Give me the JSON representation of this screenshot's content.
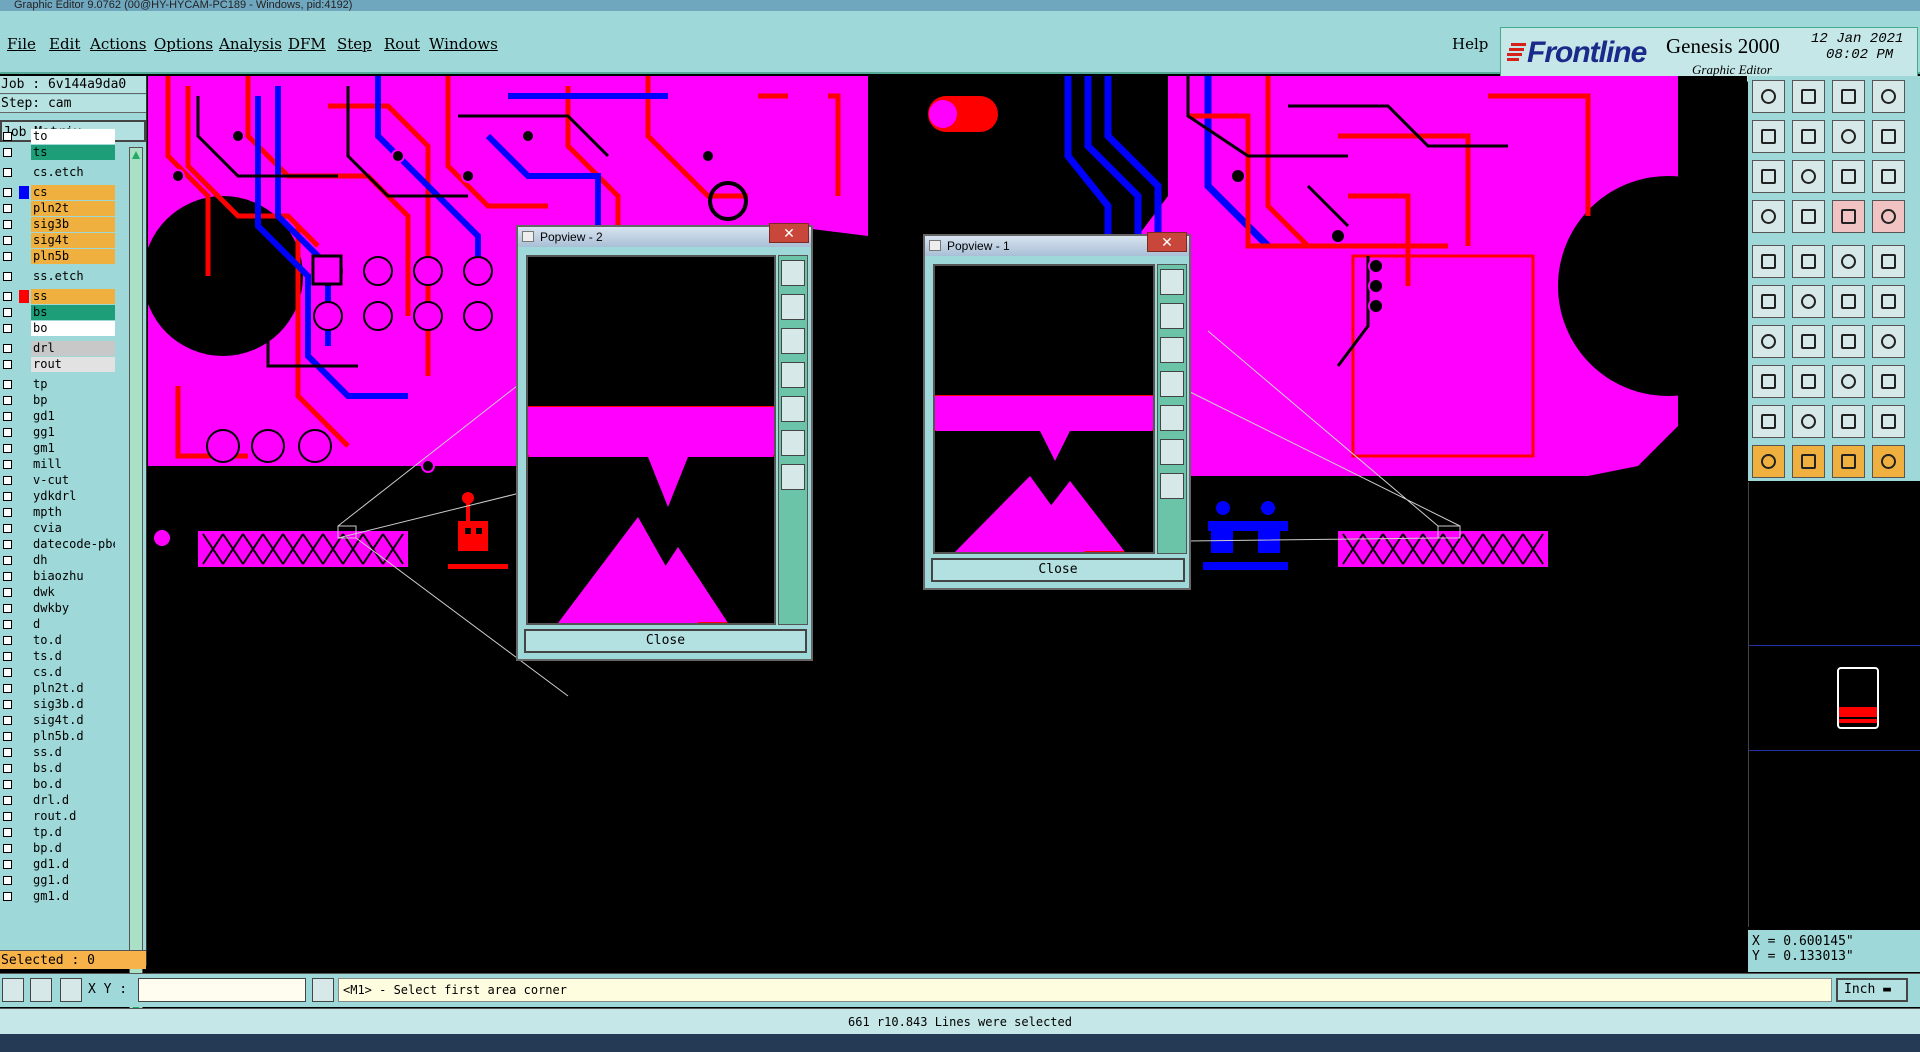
{
  "window": {
    "title": "Graphic Editor 9.0762 (00@HY-HYCAM-PC189 - Windows, pid:4192)"
  },
  "menu": {
    "items": [
      "File",
      "Edit",
      "Actions",
      "Options",
      "Analysis",
      "DFM",
      "Step",
      "Rout",
      "Windows"
    ],
    "help": "Help"
  },
  "brand": {
    "logo_text": "Frontline",
    "product": "Genesis 2000",
    "subtitle": "Graphic Editor",
    "date": "12 Jan 2021",
    "time": "08:02 PM"
  },
  "job": {
    "job_line": "Job : 6v144a9da0",
    "step_line": "Step: cam",
    "matrix_button": "Job Matrix ..."
  },
  "layers": [
    {
      "name": "to",
      "color": "#ffffff",
      "swatch": ""
    },
    {
      "name": "ts",
      "color": "#1e9e78",
      "swatch": ""
    },
    {
      "name": "cs.etch",
      "color": "#9fd8d8",
      "swatch": ""
    },
    {
      "name": "cs",
      "color": "#f0b040",
      "swatch": "#0000ff"
    },
    {
      "name": "pln2t",
      "color": "#f0b040",
      "swatch": ""
    },
    {
      "name": "sig3b",
      "color": "#f0b040",
      "swatch": ""
    },
    {
      "name": "sig4t",
      "color": "#f0b040",
      "swatch": ""
    },
    {
      "name": "pln5b",
      "color": "#f0b040",
      "swatch": ""
    },
    {
      "name": "ss.etch",
      "color": "#9fd8d8",
      "swatch": ""
    },
    {
      "name": "ss",
      "color": "#f0b040",
      "swatch": "#ff0000"
    },
    {
      "name": "bs",
      "color": "#1e9e78",
      "swatch": ""
    },
    {
      "name": "bo",
      "color": "#ffffff",
      "swatch": ""
    },
    {
      "name": "drl",
      "color": "#c8c8c8",
      "swatch": ""
    },
    {
      "name": "rout",
      "color": "#e2e2e2",
      "swatch": ""
    },
    {
      "name": "tp",
      "color": "#9fd8d8",
      "swatch": ""
    },
    {
      "name": "bp",
      "color": "#9fd8d8",
      "swatch": ""
    },
    {
      "name": "gd1",
      "color": "#9fd8d8",
      "swatch": ""
    },
    {
      "name": "gg1",
      "color": "#9fd8d8",
      "swatch": ""
    },
    {
      "name": "gm1",
      "color": "#9fd8d8",
      "swatch": ""
    },
    {
      "name": "mill",
      "color": "#9fd8d8",
      "swatch": ""
    },
    {
      "name": "v-cut",
      "color": "#9fd8d8",
      "swatch": ""
    },
    {
      "name": "ydkdrl",
      "color": "#9fd8d8",
      "swatch": ""
    },
    {
      "name": "mpth",
      "color": "#9fd8d8",
      "swatch": ""
    },
    {
      "name": "cvia",
      "color": "#9fd8d8",
      "swatch": ""
    },
    {
      "name": "datecode-pbe",
      "color": "#9fd8d8",
      "swatch": ""
    },
    {
      "name": "dh",
      "color": "#9fd8d8",
      "swatch": ""
    },
    {
      "name": "biaozhu",
      "color": "#9fd8d8",
      "swatch": ""
    },
    {
      "name": "dwk",
      "color": "#9fd8d8",
      "swatch": ""
    },
    {
      "name": "dwkby",
      "color": "#9fd8d8",
      "swatch": ""
    },
    {
      "name": "d",
      "color": "#9fd8d8",
      "swatch": ""
    },
    {
      "name": "to.d",
      "color": "#9fd8d8",
      "swatch": ""
    },
    {
      "name": "ts.d",
      "color": "#9fd8d8",
      "swatch": ""
    },
    {
      "name": "cs.d",
      "color": "#9fd8d8",
      "swatch": ""
    },
    {
      "name": "pln2t.d",
      "color": "#9fd8d8",
      "swatch": ""
    },
    {
      "name": "sig3b.d",
      "color": "#9fd8d8",
      "swatch": ""
    },
    {
      "name": "sig4t.d",
      "color": "#9fd8d8",
      "swatch": ""
    },
    {
      "name": "pln5b.d",
      "color": "#9fd8d8",
      "swatch": ""
    },
    {
      "name": "ss.d",
      "color": "#9fd8d8",
      "swatch": ""
    },
    {
      "name": "bs.d",
      "color": "#9fd8d8",
      "swatch": ""
    },
    {
      "name": "bo.d",
      "color": "#9fd8d8",
      "swatch": ""
    },
    {
      "name": "drl.d",
      "color": "#9fd8d8",
      "swatch": ""
    },
    {
      "name": "rout.d",
      "color": "#9fd8d8",
      "swatch": ""
    },
    {
      "name": "tp.d",
      "color": "#9fd8d8",
      "swatch": ""
    },
    {
      "name": "bp.d",
      "color": "#9fd8d8",
      "swatch": ""
    },
    {
      "name": "gd1.d",
      "color": "#9fd8d8",
      "swatch": ""
    },
    {
      "name": "gg1.d",
      "color": "#9fd8d8",
      "swatch": ""
    },
    {
      "name": "gm1.d",
      "color": "#9fd8d8",
      "swatch": ""
    }
  ],
  "selection": {
    "label": "Selected : 0"
  },
  "popviews": {
    "pv2": {
      "title": "Popview - 2",
      "close_label": "Close"
    },
    "pv1": {
      "title": "Popview - 1",
      "close_label": "Close"
    }
  },
  "coords": {
    "x": "X = 0.600145\"",
    "y": "Y = 0.133013\""
  },
  "bottom": {
    "xy_label": "X Y :",
    "xy_value": "",
    "prompt": "<M1> - Select first area corner",
    "units": "Inch"
  },
  "status": {
    "message": "661 r10.843 Lines were selected"
  },
  "colors": {
    "magenta": "#ff00ff",
    "red": "#ff0000",
    "blue": "#0000ff",
    "panel": "#9fd8d8",
    "orange": "#f0b040"
  },
  "tools": [
    "scroll-up-icon",
    "scroll-down-icon",
    "home-icon",
    "window-icon",
    "pan-left-icon",
    "pan-right-icon",
    "pan-split-icon",
    "snap-icon",
    "zoom-in-icon",
    "zoom-out-icon",
    "scale-icon",
    "help-icon",
    "measure-icon",
    "grid-icon",
    "layer-link-icon",
    "layer-link2-icon",
    "pad-icon",
    "line-icon",
    "text-icon",
    "circle-icon",
    "node-icon",
    "cross-icon",
    "connect-icon",
    "move-icon",
    "angle-icon",
    "slash-icon",
    "arc-icon",
    "flag-icon",
    "select-pad-icon",
    "dash-icon",
    "crosshair-icon",
    "copy-icon",
    "triangle-icon",
    "triangle2-icon",
    "triangle3-icon",
    "triangle4-icon",
    "pointer-icon",
    "pointer-box-icon",
    "pointer-lasso-icon",
    "pointer-net-icon"
  ]
}
